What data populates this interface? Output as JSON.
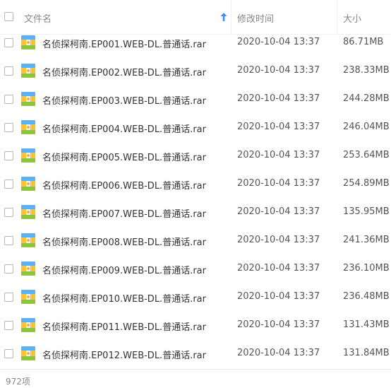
{
  "header": {
    "name_label": "文件名",
    "time_label": "修改时间",
    "size_label": "大小",
    "sort_icon": "arrow-up-icon",
    "sort_color": "#3b8cff"
  },
  "rows": [
    {
      "name": "名侦探柯南.EP001.WEB-DL.普通话.rar",
      "time": "2020-10-04 13:37",
      "size": "86.71MB"
    },
    {
      "name": "名侦探柯南.EP002.WEB-DL.普通话.rar",
      "time": "2020-10-04 13:37",
      "size": "238.33MB"
    },
    {
      "name": "名侦探柯南.EP003.WEB-DL.普通话.rar",
      "time": "2020-10-04 13:37",
      "size": "244.28MB"
    },
    {
      "name": "名侦探柯南.EP004.WEB-DL.普通话.rar",
      "time": "2020-10-04 13:37",
      "size": "246.04MB"
    },
    {
      "name": "名侦探柯南.EP005.WEB-DL.普通话.rar",
      "time": "2020-10-04 13:37",
      "size": "253.64MB"
    },
    {
      "name": "名侦探柯南.EP006.WEB-DL.普通话.rar",
      "time": "2020-10-04 13:37",
      "size": "254.89MB"
    },
    {
      "name": "名侦探柯南.EP007.WEB-DL.普通话.rar",
      "time": "2020-10-04 13:37",
      "size": "135.95MB"
    },
    {
      "name": "名侦探柯南.EP008.WEB-DL.普通话.rar",
      "time": "2020-10-04 13:37",
      "size": "241.36MB"
    },
    {
      "name": "名侦探柯南.EP009.WEB-DL.普通话.rar",
      "time": "2020-10-04 13:37",
      "size": "236.10MB"
    },
    {
      "name": "名侦探柯南.EP010.WEB-DL.普通话.rar",
      "time": "2020-10-04 13:37",
      "size": "236.48MB"
    },
    {
      "name": "名侦探柯南.EP011.WEB-DL.普通话.rar",
      "time": "2020-10-04 13:37",
      "size": "131.43MB"
    },
    {
      "name": "名侦探柯南.EP012.WEB-DL.普通话.rar",
      "time": "2020-10-04 13:37",
      "size": "131.84MB"
    }
  ],
  "row_icon": "rar-archive-icon",
  "footer": {
    "count_text": "972项"
  }
}
